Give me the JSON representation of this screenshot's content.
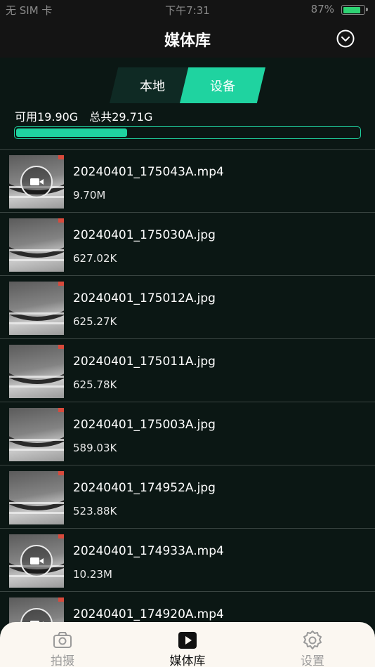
{
  "status": {
    "carrier": "无 SIM 卡",
    "time": "下午7:31",
    "battery_text": "87%",
    "battery_level": 0.87
  },
  "header": {
    "title": "媒体库",
    "dropdown_icon": "chevron-down-circle-icon"
  },
  "segment": {
    "local": "本地",
    "device": "设备",
    "active": "device"
  },
  "storage": {
    "available": "可用19.90G",
    "total": "总共29.71G",
    "used_fraction": 0.33
  },
  "files": [
    {
      "name": "20240401_175043A.mp4",
      "size": "9.70M",
      "type": "video"
    },
    {
      "name": "20240401_175030A.jpg",
      "size": "627.02K",
      "type": "image"
    },
    {
      "name": "20240401_175012A.jpg",
      "size": "625.27K",
      "type": "image"
    },
    {
      "name": "20240401_175011A.jpg",
      "size": "625.78K",
      "type": "image"
    },
    {
      "name": "20240401_175003A.jpg",
      "size": "589.03K",
      "type": "image"
    },
    {
      "name": "20240401_174952A.jpg",
      "size": "523.88K",
      "type": "image"
    },
    {
      "name": "20240401_174933A.mp4",
      "size": "10.23M",
      "type": "video"
    },
    {
      "name": "20240401_174920A.mp4",
      "size": "",
      "type": "video"
    }
  ],
  "tabbar": {
    "shoot": "拍摄",
    "media": "媒体库",
    "settings": "设置",
    "active": "media"
  },
  "colors": {
    "accent": "#1fd3a0",
    "background": "#0b1714",
    "header": "#141414",
    "tabbar": "#fbf7f1"
  }
}
